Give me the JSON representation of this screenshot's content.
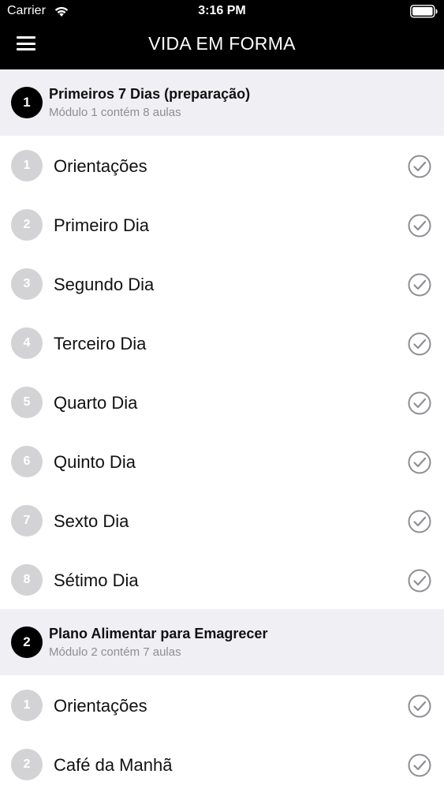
{
  "status": {
    "carrier": "Carrier",
    "time": "3:16 PM"
  },
  "nav": {
    "title": "VIDA EM FORMA",
    "menu_icon": "hamburger-menu-icon"
  },
  "modules": [
    {
      "number": "1",
      "title": "Primeiros 7 Dias (preparação)",
      "subtitle": "Módulo 1 contém 8 aulas",
      "lessons": [
        {
          "number": "1",
          "title": "Orientações"
        },
        {
          "number": "2",
          "title": "Primeiro Dia"
        },
        {
          "number": "3",
          "title": "Segundo Dia"
        },
        {
          "number": "4",
          "title": "Terceiro Dia"
        },
        {
          "number": "5",
          "title": "Quarto Dia"
        },
        {
          "number": "6",
          "title": "Quinto Dia"
        },
        {
          "number": "7",
          "title": "Sexto Dia"
        },
        {
          "number": "8",
          "title": "Sétimo Dia"
        }
      ]
    },
    {
      "number": "2",
      "title": "Plano Alimentar para Emagrecer",
      "subtitle": "Módulo 2 contém 7 aulas",
      "lessons": [
        {
          "number": "1",
          "title": "Orientações"
        },
        {
          "number": "2",
          "title": "Café da Manhã"
        }
      ]
    }
  ],
  "colors": {
    "header_bg": "#000000",
    "module_bg": "#efeff4",
    "lesson_badge": "#d3d3d6",
    "check": "#8e8e93"
  }
}
